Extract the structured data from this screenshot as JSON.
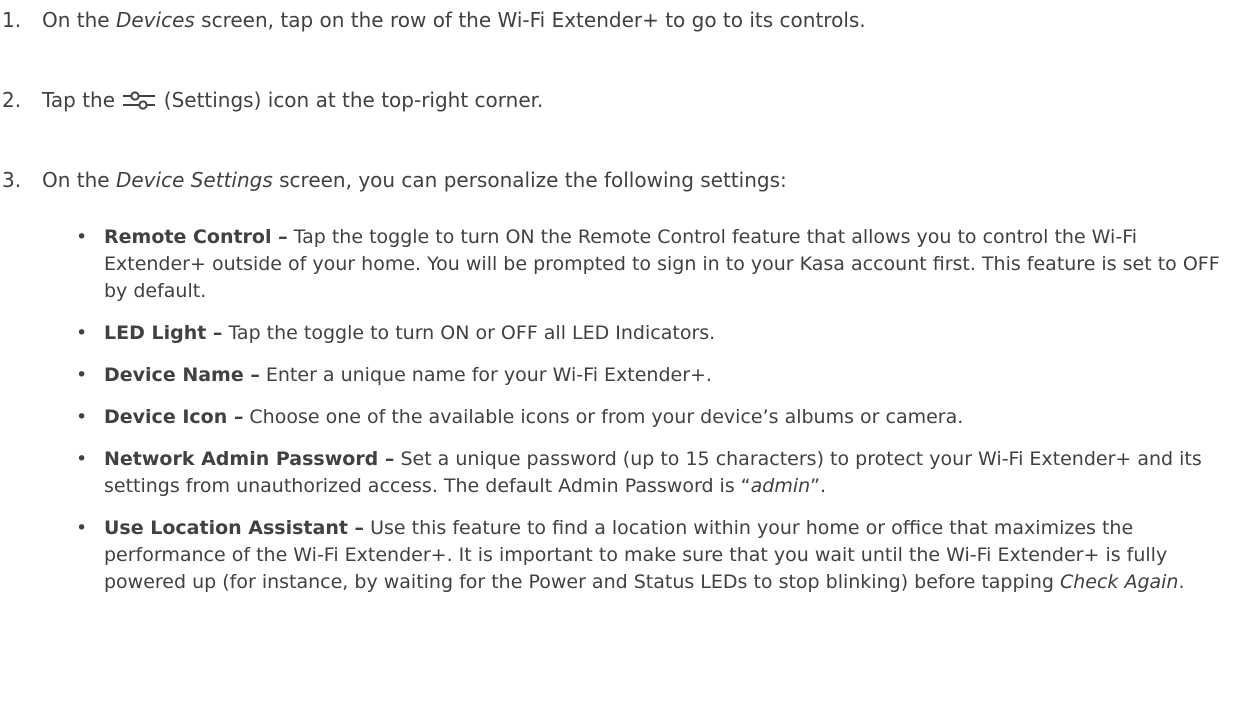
{
  "steps": [
    {
      "number": "1.",
      "text_before": "On the ",
      "text_em": "Devices",
      "text_after": " screen, tap on the row of the Wi-Fi Extender+ to go to its controls."
    },
    {
      "number": "2.",
      "text_before": "Tap the ",
      "icon": "settings-sliders-icon",
      "text_after": " (Settings) icon at the top-right corner."
    },
    {
      "number": "3.",
      "text_before": "On the ",
      "text_em": "Device Settings",
      "text_after": " screen, you can personalize the following settings:"
    }
  ],
  "bullets": [
    {
      "marker": "•",
      "title": "Remote Control –",
      "body": " Tap the toggle to turn ON the Remote Control feature that allows you to control the Wi-Fi Extender+ outside of your home. You will be prompted to sign in to your Kasa account first. This feature is set to OFF by default."
    },
    {
      "marker": "•",
      "title": "LED Light –",
      "body": " Tap the toggle to turn ON or OFF all LED Indicators."
    },
    {
      "marker": "•",
      "title": "Device Name –",
      "body": " Enter a unique name for your Wi-Fi Extender+."
    },
    {
      "marker": "•",
      "title": "Device Icon –",
      "body": " Choose one of the available icons or from your device’s albums or camera."
    },
    {
      "marker": "•",
      "title": "Network Admin Password –",
      "body": " Set a unique password (up to 15 characters) to protect your Wi-Fi Extender+ and its settings from unauthorized access. The default Admin Password is “",
      "body_em": "admin",
      "body_after": "”."
    },
    {
      "marker": "•",
      "title": "Use Location Assistant –",
      "body": " Use this feature to find a location within your home or office that maximizes the performance of the Wi-Fi Extender+. It is important to make sure that you wait until the Wi-Fi Extender+ is fully powered up (for instance, by waiting for the Power and Status LEDs to stop blinking) before tapping ",
      "body_em": "Check Again",
      "body_after": "."
    }
  ],
  "colors": {
    "text": "#414042",
    "background": "#ffffff"
  }
}
